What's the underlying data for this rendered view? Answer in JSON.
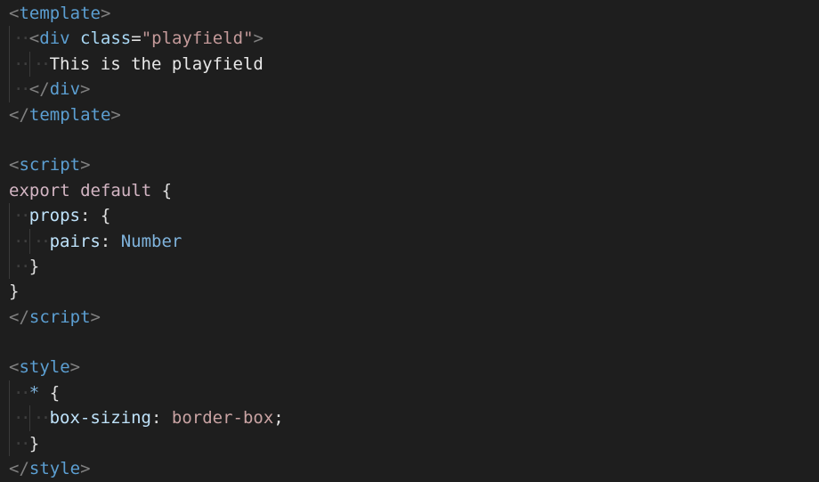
{
  "editor": {
    "lines": [
      {
        "indent": 0,
        "tokens": [
          [
            "bracket",
            "<"
          ],
          [
            "tag",
            "template"
          ],
          [
            "bracket",
            ">"
          ]
        ]
      },
      {
        "indent": 1,
        "tokens": [
          [
            "bracket",
            "<"
          ],
          [
            "tag",
            "div"
          ],
          [
            "text",
            " "
          ],
          [
            "attr",
            "class"
          ],
          [
            "punct",
            "="
          ],
          [
            "str",
            "\"playfield\""
          ],
          [
            "bracket",
            ">"
          ]
        ]
      },
      {
        "indent": 2,
        "tokens": [
          [
            "text",
            "This is the playfield"
          ]
        ]
      },
      {
        "indent": 1,
        "tokens": [
          [
            "bracket",
            "</"
          ],
          [
            "tag",
            "div"
          ],
          [
            "bracket",
            ">"
          ]
        ]
      },
      {
        "indent": 0,
        "tokens": [
          [
            "bracket",
            "</"
          ],
          [
            "tag",
            "template"
          ],
          [
            "bracket",
            ">"
          ]
        ]
      },
      {
        "indent": 0,
        "tokens": []
      },
      {
        "indent": 0,
        "tokens": [
          [
            "bracket",
            "<"
          ],
          [
            "tag",
            "script"
          ],
          [
            "bracket",
            ">"
          ]
        ]
      },
      {
        "indent": 0,
        "tokens": [
          [
            "kw",
            "export default"
          ],
          [
            "punct",
            " {"
          ]
        ]
      },
      {
        "indent": 1,
        "tokens": [
          [
            "prop",
            "props"
          ],
          [
            "punct",
            ": {"
          ]
        ]
      },
      {
        "indent": 2,
        "tokens": [
          [
            "prop",
            "pairs"
          ],
          [
            "punct",
            ": "
          ],
          [
            "type",
            "Number"
          ]
        ]
      },
      {
        "indent": 1,
        "tokens": [
          [
            "punct",
            "}"
          ]
        ]
      },
      {
        "indent": 0,
        "tokens": [
          [
            "punct",
            "}"
          ]
        ]
      },
      {
        "indent": 0,
        "tokens": [
          [
            "bracket",
            "</"
          ],
          [
            "tag",
            "script"
          ],
          [
            "bracket",
            ">"
          ]
        ]
      },
      {
        "indent": 0,
        "tokens": []
      },
      {
        "indent": 0,
        "tokens": [
          [
            "bracket",
            "<"
          ],
          [
            "tag",
            "style"
          ],
          [
            "bracket",
            ">"
          ]
        ]
      },
      {
        "indent": 1,
        "tokens": [
          [
            "type",
            "*"
          ],
          [
            "punct",
            " {"
          ]
        ]
      },
      {
        "indent": 2,
        "tokens": [
          [
            "prop",
            "box-sizing"
          ],
          [
            "punct",
            ": "
          ],
          [
            "val",
            "border-box"
          ],
          [
            "punct",
            ";"
          ]
        ]
      },
      {
        "indent": 1,
        "tokens": [
          [
            "punct",
            "}"
          ]
        ]
      },
      {
        "indent": 0,
        "tokens": [
          [
            "bracket",
            "</"
          ],
          [
            "tag",
            "style"
          ],
          [
            "bracket",
            ">"
          ]
        ]
      }
    ]
  },
  "colors": {
    "background": "#1e1e1e",
    "tag": "#5c9fd2",
    "attribute": "#a9d8f5",
    "string": "#c49a9a",
    "bracket": "#808080"
  }
}
